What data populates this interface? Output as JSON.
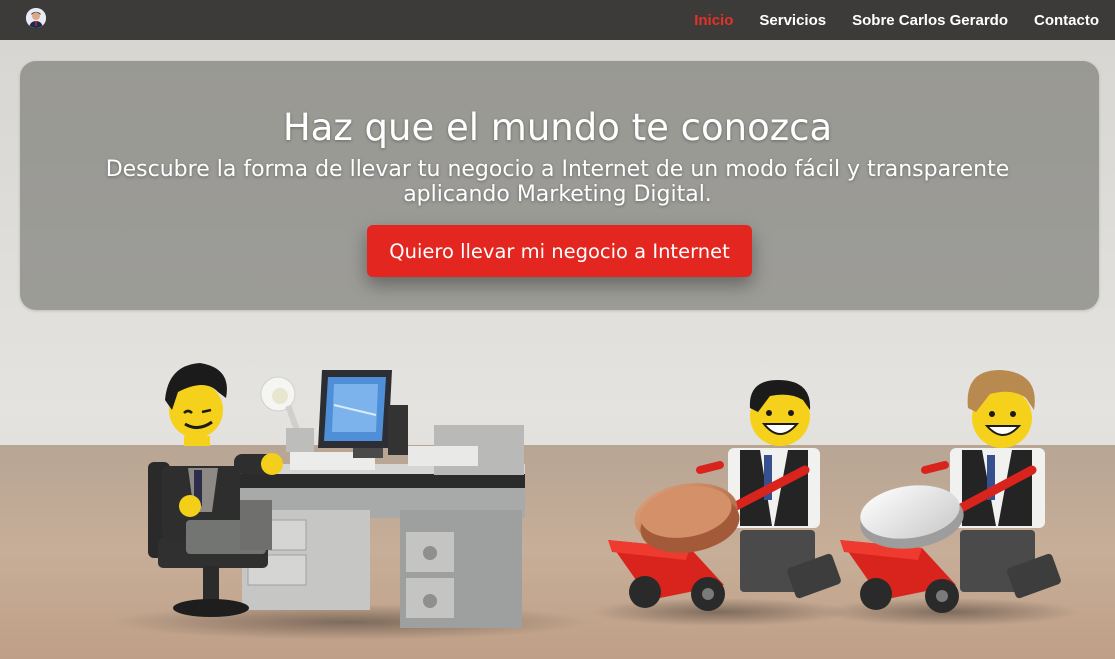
{
  "nav": {
    "logo_alt": "avatar",
    "items": [
      {
        "label": "Inicio",
        "active": true
      },
      {
        "label": "Servicios",
        "active": false
      },
      {
        "label": "Sobre Carlos Gerardo",
        "active": false
      },
      {
        "label": "Contacto",
        "active": false
      }
    ]
  },
  "hero": {
    "title": "Haz que el mundo te conozca",
    "subtitle": "Descubre la forma de llevar tu negocio a Internet de un modo fácil y transparente aplicando Marketing Digital.",
    "cta_label": "Quiero llevar mi negocio a Internet"
  },
  "colors": {
    "navbar": "#3c3b39",
    "accent": "#e3261f",
    "active_link": "#e53226",
    "text": "#ffffff"
  },
  "background_image": "lego-office-scene"
}
